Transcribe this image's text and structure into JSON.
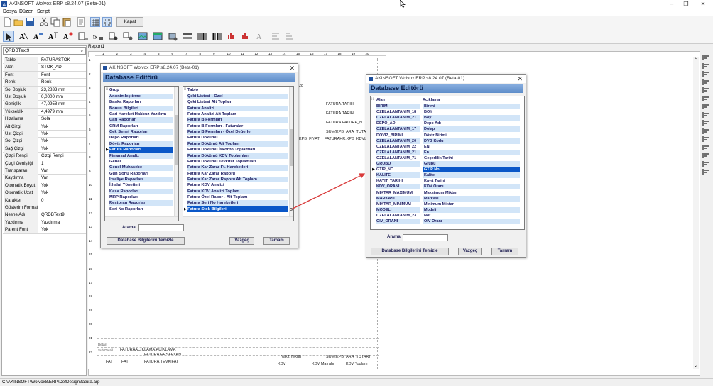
{
  "app": {
    "title": "AKINSOFT Wolvox ERP s8.24.07 (Beta-01)",
    "menu": [
      "Dosya",
      "Düzen",
      "Script"
    ],
    "close_button": "Kapat",
    "status_path": "C:\\AKINSOFT\\Wolvox8\\ERP\\DefDesign\\fatura.arp",
    "report_tab": "Report1"
  },
  "inspector": {
    "selected_component": "QRDBText9",
    "properties": [
      {
        "name": "Tablo",
        "value": "FATURASTOK"
      },
      {
        "name": "Alan",
        "value": "STOK_ADI"
      },
      {
        "name": "Font",
        "value": "Font"
      },
      {
        "name": "Renk",
        "value": "Renk"
      },
      {
        "name": "Sol Boşluk",
        "value": "23,2833 mm"
      },
      {
        "name": "Üst Boşluk",
        "value": "0,0000 mm"
      },
      {
        "name": "Genişlik",
        "value": "47,0958 mm"
      },
      {
        "name": "Yükseklik",
        "value": "4,4979 mm"
      },
      {
        "name": "Hizalama",
        "value": "Sola"
      },
      {
        "name": "Alt Çizgi",
        "value": "Yok"
      },
      {
        "name": "Üst Çizgi",
        "value": "Yok"
      },
      {
        "name": "Sol Çizgi",
        "value": "Yok"
      },
      {
        "name": "Sağ Çizgi",
        "value": "Yok"
      },
      {
        "name": "Çizgi Rengi",
        "value": "Çizgi Rengi"
      },
      {
        "name": "Çizgi Genişliği",
        "value": "1"
      },
      {
        "name": "Transparan",
        "value": "Var"
      },
      {
        "name": "Kaydırma",
        "value": "Var"
      },
      {
        "name": "Otomatik Boyut",
        "value": "Yok"
      },
      {
        "name": "Otomatik Uzat",
        "value": "Yok"
      },
      {
        "name": "Karakter",
        "value": "0"
      },
      {
        "name": "Gösterim Formatı",
        "value": ""
      },
      {
        "name": "Nesne Adı",
        "value": "QRDBText9"
      },
      {
        "name": "Yazdırma",
        "value": "Yazdırma"
      },
      {
        "name": "Parent Font",
        "value": "Yok"
      }
    ]
  },
  "designer": {
    "ruler_ticks": [
      "1",
      "2",
      "3",
      "4",
      "5",
      "6",
      "7",
      "8",
      "9",
      "10",
      "11",
      "12",
      "13",
      "14",
      "15",
      "16",
      "17",
      "18",
      "19",
      "20"
    ],
    "vruler_ticks": [
      "1",
      "2",
      "3",
      "4",
      "5",
      "6",
      "7",
      "8",
      "9",
      "10",
      "11",
      "12",
      "13",
      "14",
      "15",
      "16",
      "17",
      "18",
      "19",
      "20",
      "21",
      "22"
    ],
    "fields": [
      {
        "text": "FATURA.TARIHI"
      },
      {
        "text": "FATURA.TARIHI"
      },
      {
        "text": "FATURA.FATURA_N"
      },
      {
        "text": "SUM(KPB_ARA_TUTA"
      },
      {
        "text": "KPB_FIYATI"
      },
      {
        "text": "FATURAHR.KPB_KDVL"
      },
      {
        "text": "28"
      },
      {
        "text": "Detail"
      },
      {
        "text": "Sub Detail"
      },
      {
        "text": "FATURAACIKLAMA.ACIKLAMA"
      },
      {
        "text": "FATURA.HESAPLAN"
      },
      {
        "text": "FATURA.TEVKIFAT"
      },
      {
        "text": "FAT"
      },
      {
        "text": "FAT"
      },
      {
        "text": "Nakit Yekün"
      },
      {
        "text": "SUM(KPB_ARA_TUTAR)"
      },
      {
        "text": "KDV"
      },
      {
        "text": "KDV Matrahı"
      },
      {
        "text": "KDV Toplam"
      }
    ]
  },
  "dialog1": {
    "title": "AKINSOFT Wolvox ERP s8.24.07 (Beta-01)",
    "heading": "Database Editörü",
    "group_header": "Grup",
    "groups": [
      "Anonimleştirme",
      "Banka Raporları",
      "Bonus Bilgileri",
      "Cari Hareket Hakbuz Yazdırm",
      "Cari Raporları",
      "CRM Raporları",
      "Çek Senet Raporları",
      "Depo Raporları",
      "Döviz Raporları",
      "Fatura Raporları",
      "Finansal Analiz",
      "Genel",
      "Genel Muhasebe",
      "Gün Sonu Raporları",
      "İrsaliye Raporları",
      "İthalat Yönetimi",
      "Kasa Raporları",
      "MRP Raporları",
      "Restoran Raporları",
      "Seri No Raporları"
    ],
    "table_header": "Tablo",
    "tables": [
      "Çeki Listesi - Özel",
      "Çeki Listesi Alt Toplam",
      "Fatura Analizi",
      "Fatura Analizi Alt Toplam",
      "Fatura B Formları",
      "Fatura B Formları - Faturalar",
      "Fatura B Formları - Özel Değerler",
      "Fatura Dökümü",
      "Fatura Dökümü Alt Toplam",
      "Fatura Dökümü İskonto Toplamları",
      "Fatura Dökümü KDV Toplamları",
      "Fatura Dökümü Tevkifat Toplamları",
      "Fatura Kar Zarar Ft. Hareketleri",
      "Fatura Kar Zarar Raporu",
      "Fatura Kar Zarar Raporu Alt Toplam",
      "Fatura KDV Analizi",
      "Fatura KDV Analizi Toplam",
      "Fatura Özel Rapor - Alt Toplam",
      "Fatura Seri No Hareketleri",
      "Fatura Stok Bilgileri"
    ],
    "search_label": "Arama",
    "clear_button": "Database Bilgilerini Temizle",
    "cancel_button": "Vazgeç",
    "ok_button": "Tamam"
  },
  "dialog2": {
    "title": "AKINSOFT Wolvox ERP s8.24.07 (Beta-01)",
    "heading": "Database Editörü",
    "col_field": "Alan",
    "col_desc": "Açıklama",
    "rows": [
      {
        "field": "BIRIMI",
        "desc": "Birimi"
      },
      {
        "field": "OZELALANTANIM_18",
        "desc": "BOY"
      },
      {
        "field": "OZELALANTANIM_21",
        "desc": "Boy"
      },
      {
        "field": "DEPO_ADI",
        "desc": "Depo Adı"
      },
      {
        "field": "OZELALANTANIM_17",
        "desc": "Dolap"
      },
      {
        "field": "DOVIZ_BIRIMI",
        "desc": "Döviz Birimi"
      },
      {
        "field": "OZELALANTANIM_20",
        "desc": "DVG Kodu"
      },
      {
        "field": "OZELALANTANIM_22",
        "desc": "EN"
      },
      {
        "field": "OZELALANTANIM_21",
        "desc": "En"
      },
      {
        "field": "OZELALANTANIM_71",
        "desc": "Geçerlilik Tarihi"
      },
      {
        "field": "GRUBU",
        "desc": "Grubu"
      },
      {
        "field": "GTIP_NO",
        "desc": "GTIP No"
      },
      {
        "field": "KALITE",
        "desc": "Kalite"
      },
      {
        "field": "KAYIT_TARIHI",
        "desc": "Kayıt Tarihi"
      },
      {
        "field": "KDV_ORANI",
        "desc": "KDV Oranı"
      },
      {
        "field": "MIKTAR_MAXIMUM",
        "desc": "Maksimum Miktar"
      },
      {
        "field": "MARKASI",
        "desc": "Markası"
      },
      {
        "field": "MIKTAR_MINIMUM",
        "desc": "Minimum Miktar"
      },
      {
        "field": "MODELI",
        "desc": "Modeli"
      },
      {
        "field": "OZELALANTANIM_23",
        "desc": "Not"
      },
      {
        "field": "OIV_ORANI",
        "desc": "ÖİV Oranı"
      }
    ],
    "search_label": "Arama",
    "clear_button": "Database Bilgilerini Temizle",
    "cancel_button": "Vazgeç",
    "ok_button": "Tamam"
  },
  "colors": {
    "selection": "#0a57c8",
    "stripe": "#d2e5f8",
    "heading_bg": "#5d8cc9",
    "arrow": "#d93a3a"
  },
  "icons": [
    "new-file-icon",
    "open-folder-icon",
    "save-icon",
    "cut-icon",
    "copy-icon",
    "paste-icon",
    "preview-icon",
    "grid-icon",
    "snap-icon",
    "pointer-icon",
    "label-tool-icon",
    "dbtext-tool-icon",
    "expr-tool-icon",
    "sysdata-tool-icon",
    "shape-tool-icon",
    "image-tool-icon",
    "barcode-tool-icon",
    "richtext-tool-icon",
    "chart-tool-icon"
  ]
}
